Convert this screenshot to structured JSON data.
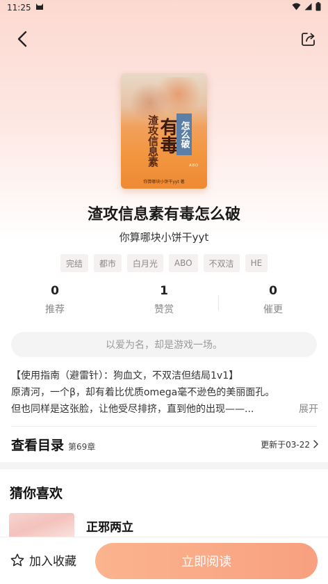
{
  "status_bar": {
    "time": "11:25"
  },
  "book": {
    "title": "渣攻信息素有毒怎么破",
    "author": "你算哪块小饼干yyt",
    "cover": {
      "title_small": "渣攻信息素",
      "title_big": "有毒",
      "tag": "怎么破",
      "abo_mark": "ABO",
      "author_line": "你算哪块小饼干yyt 著"
    },
    "tags": [
      "完结",
      "都市",
      "白月光",
      "ABO",
      "不双洁",
      "HE"
    ]
  },
  "stats": [
    {
      "value": "0",
      "label": "推荐"
    },
    {
      "value": "1",
      "label": "赞赏"
    },
    {
      "value": "0",
      "label": "催更"
    }
  ],
  "slogan": "以爱为名，却是游戏一场。",
  "intro": {
    "lines": [
      "【使用指南（避雷针）：狗血文，不双洁但结局1v1】",
      "原清河，一个β，却有着比优质omega毫不逊色的美丽面孔。",
      "但也同样是这张脸，让他受尽排挤，直到他的出现——..."
    ],
    "expand_label": "展开"
  },
  "catalog": {
    "title": "查看目录",
    "count": "第69章",
    "updated": "更新于03-22"
  },
  "recommend": {
    "title": "猜你喜欢",
    "items": [
      {
        "name": "正邪两立"
      }
    ]
  },
  "bottom": {
    "favorite_label": "加入收藏",
    "read_label": "立即阅读"
  },
  "colors": {
    "accent": "#f8a07f",
    "cover_orange": "#f39640",
    "hero_pink": "#fcd9d0"
  }
}
